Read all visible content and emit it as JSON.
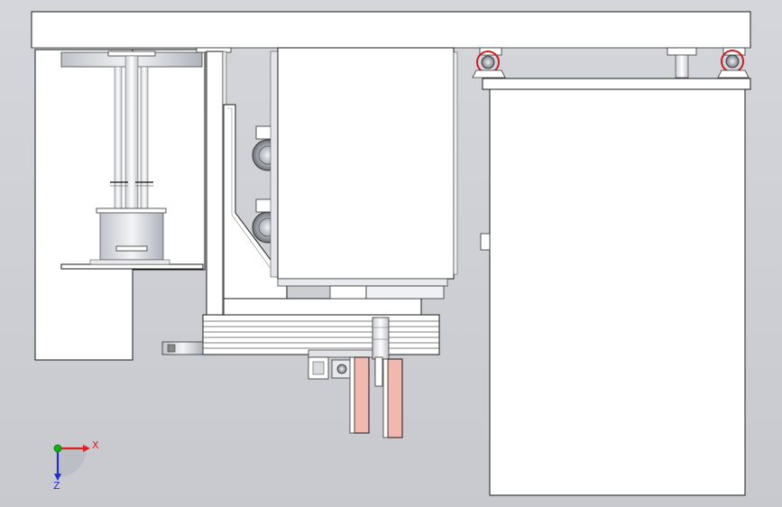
{
  "triad": {
    "x_label": "X",
    "z_label": "Z",
    "colors": {
      "x": "#e02020",
      "y": "#10b010",
      "z": "#2030d0"
    }
  },
  "colors": {
    "background": "#cdd0d6",
    "panel_fill": "#ffffff",
    "outline": "#1a1a1a",
    "guide_fill": "#f2b7ad",
    "caster_wheel": "#cc2020",
    "metal_shade": "#d9dce2"
  }
}
